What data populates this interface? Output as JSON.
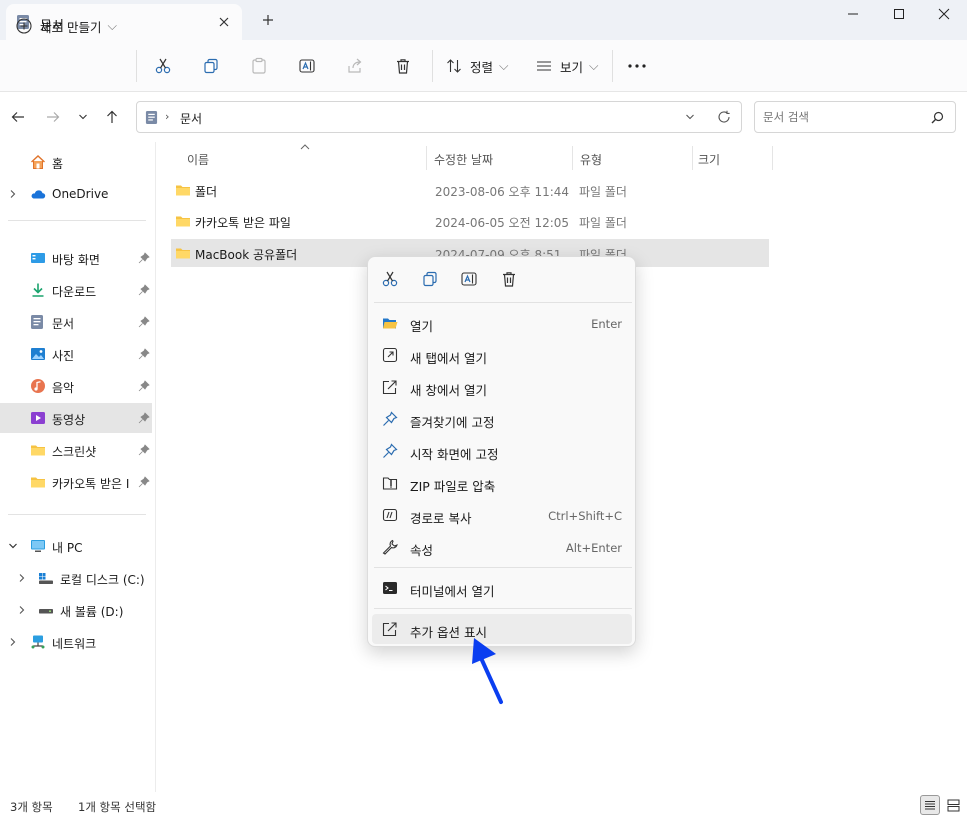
{
  "window": {
    "tab_title": "문서",
    "icons": {
      "tab": "document-icon",
      "close": "close-icon",
      "new_tab": "plus-icon"
    }
  },
  "toolbar": {
    "new_label": "새로 만들기",
    "sort_label": "정렬",
    "view_label": "보기"
  },
  "address": {
    "path": "문서",
    "search_placeholder": "문서 검색"
  },
  "sidebar": {
    "home": "홈",
    "onedrive": "OneDrive",
    "pinned": [
      "바탕 화면",
      "다운로드",
      "문서",
      "사진",
      "음악",
      "동영상",
      "스크린샷",
      "카카오톡 받은 I"
    ],
    "this_pc": "내 PC",
    "drives": [
      "로컬 디스크 (C:)",
      "새 볼륨 (D:)"
    ],
    "network": "네트워크"
  },
  "files": {
    "columns": {
      "name": "이름",
      "modified": "수정한 날짜",
      "type": "유형",
      "size": "크기"
    },
    "rows": [
      {
        "name": "폴더",
        "modified": "2023-08-06 오후 11:44",
        "type": "파일 폴더"
      },
      {
        "name": "카카오톡 받은 파일",
        "modified": "2024-06-05 오전 12:05",
        "type": "파일 폴더"
      },
      {
        "name": "MacBook 공유폴더",
        "modified": "2024-07-09 오후 8:51",
        "type": "파일 폴더",
        "selected": true
      }
    ]
  },
  "context_menu": {
    "items": [
      {
        "label": "열기",
        "shortcut": "Enter",
        "icon": "folder-open-icon"
      },
      {
        "label": "새 탭에서 열기",
        "shortcut": "",
        "icon": "new-tab-icon"
      },
      {
        "label": "새 창에서 열기",
        "shortcut": "",
        "icon": "new-window-icon"
      },
      {
        "label": "즐겨찾기에 고정",
        "shortcut": "",
        "icon": "pin-icon"
      },
      {
        "label": "시작 화면에 고정",
        "shortcut": "",
        "icon": "pin-icon"
      },
      {
        "label": "ZIP 파일로 압축",
        "shortcut": "",
        "icon": "zip-icon"
      },
      {
        "label": "경로로 복사",
        "shortcut": "Ctrl+Shift+C",
        "icon": "copy-path-icon"
      },
      {
        "label": "속성",
        "shortcut": "Alt+Enter",
        "icon": "wrench-icon"
      }
    ],
    "terminal": {
      "label": "터미널에서 열기",
      "icon": "terminal-icon"
    },
    "more": {
      "label": "추가 옵션 표시",
      "icon": "more-options-icon"
    }
  },
  "status": {
    "count": "3개 항목",
    "selected": "1개 항목 선택함"
  },
  "colors": {
    "accent": "#0a3ef0",
    "folder": "#f6c343",
    "selection": "#e5e5e5"
  }
}
